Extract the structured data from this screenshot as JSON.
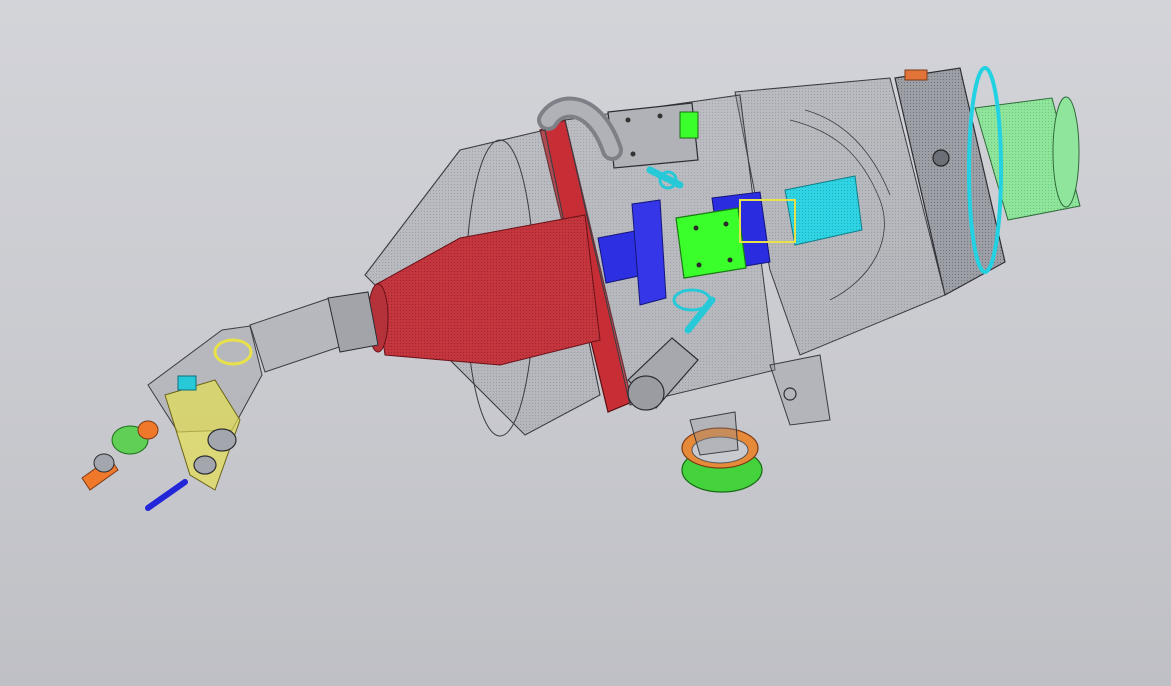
{
  "viewport": {
    "background_top": "#d3d4d9",
    "background_bottom": "#bfc0c5"
  },
  "model": {
    "shell_fill": "#8c8f96",
    "shell_stroke": "#3a3c42",
    "red_part": "#c0323a",
    "blue_part": "#2a2ee0",
    "green_part": "#39ff2a",
    "cyan_part": "#25d6e6",
    "orange_part": "#ff7a1a",
    "yellow_part": "#e8e24a",
    "light_green_part": "#8ee89a"
  }
}
